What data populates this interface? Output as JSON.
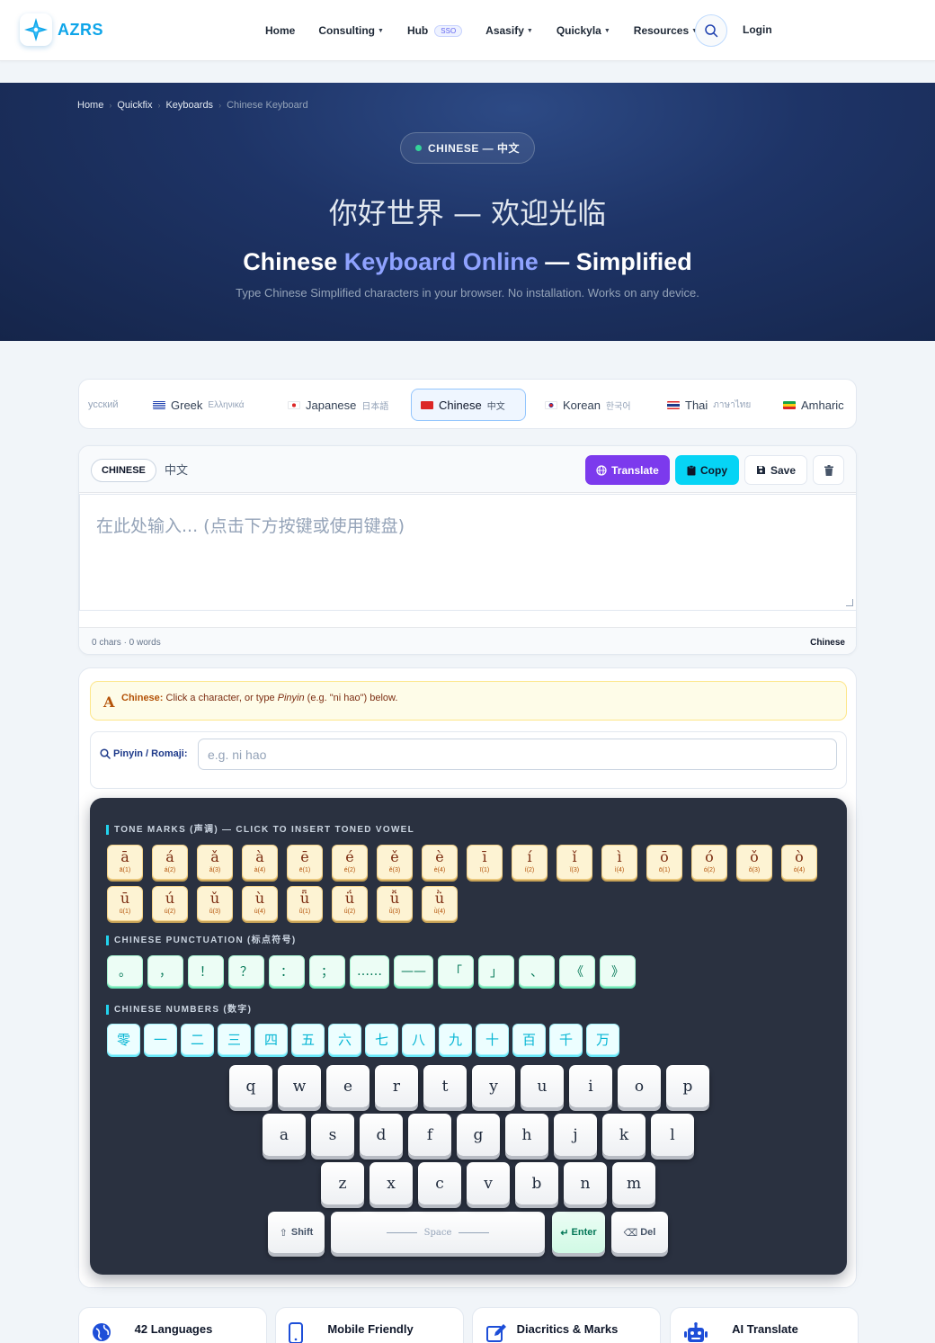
{
  "brand": {
    "name": "AZRS"
  },
  "nav": {
    "items": [
      {
        "label": "Home",
        "dropdown": false
      },
      {
        "label": "Consulting",
        "dropdown": true
      },
      {
        "label": "Hub",
        "dropdown": false,
        "badge": "SSO"
      },
      {
        "label": "Asasify",
        "dropdown": true
      },
      {
        "label": "Quickyla",
        "dropdown": true
      },
      {
        "label": "Resources",
        "dropdown": true
      }
    ],
    "login": "Login"
  },
  "breadcrumb": [
    "Home",
    "Quickfix",
    "Keyboards",
    "Chinese Keyboard"
  ],
  "hero": {
    "pill": "CHINESE — 中文",
    "greeting": "你好世界 — 欢迎光临",
    "title_part1": "Chinese ",
    "title_accent": "Keyboard Online",
    "title_part2": " — Simplified",
    "subtitle": "Type Chinese Simplified characters in your browser. No installation. Works on any device."
  },
  "language_tabs": [
    {
      "label": "",
      "native": "усский",
      "flag": ""
    },
    {
      "label": "Greek",
      "native": "Ελληνικά",
      "flag": "gr"
    },
    {
      "label": "Japanese",
      "native": "日本語",
      "flag": "jp"
    },
    {
      "label": "Chinese",
      "native": "中文",
      "flag": "cn",
      "active": true
    },
    {
      "label": "Korean",
      "native": "한국어",
      "flag": "kr"
    },
    {
      "label": "Thai",
      "native": "ภาษาไทย",
      "flag": "th"
    },
    {
      "label": "Amharic",
      "native": "",
      "flag": "et"
    }
  ],
  "editor": {
    "lang_chip": "CHINESE",
    "lang_native": "中文",
    "translate_label": "Translate",
    "copy_label": "Copy",
    "save_label": "Save",
    "placeholder": "在此处输入... (点击下方按键或使用键盘)",
    "counts": "0 chars · 0 words",
    "status_lang": "Chinese"
  },
  "hint": {
    "bold": "Chinese:",
    "pre": " Click a character, or type ",
    "italic": "Pinyin",
    "post": " (e.g. \"ni hao\") below."
  },
  "pinyin": {
    "label": "Pinyin / Romaji:",
    "placeholder": "e.g. ni hao"
  },
  "sections": {
    "tones": "TONE MARKS (声调) — CLICK TO INSERT TONED VOWEL",
    "punctuation": "CHINESE PUNCTUATION (标点符号)",
    "numbers": "CHINESE NUMBERS (数字)"
  },
  "tones": [
    {
      "c": "ā",
      "s": "ā(1)"
    },
    {
      "c": "á",
      "s": "á(2)"
    },
    {
      "c": "ǎ",
      "s": "ǎ(3)"
    },
    {
      "c": "à",
      "s": "à(4)"
    },
    {
      "c": "ē",
      "s": "ē(1)"
    },
    {
      "c": "é",
      "s": "é(2)"
    },
    {
      "c": "ě",
      "s": "ě(3)"
    },
    {
      "c": "è",
      "s": "è(4)"
    },
    {
      "c": "ī",
      "s": "ī(1)"
    },
    {
      "c": "í",
      "s": "í(2)"
    },
    {
      "c": "ǐ",
      "s": "ǐ(3)"
    },
    {
      "c": "ì",
      "s": "ì(4)"
    },
    {
      "c": "ō",
      "s": "ō(1)"
    },
    {
      "c": "ó",
      "s": "ó(2)"
    },
    {
      "c": "ǒ",
      "s": "ǒ(3)"
    },
    {
      "c": "ò",
      "s": "ò(4)"
    },
    {
      "c": "ū",
      "s": "ū(1)"
    },
    {
      "c": "ú",
      "s": "ú(2)"
    },
    {
      "c": "ǔ",
      "s": "ǔ(3)"
    },
    {
      "c": "ù",
      "s": "ù(4)"
    },
    {
      "c": "ǖ",
      "s": "ǖ(1)"
    },
    {
      "c": "ǘ",
      "s": "ǘ(2)"
    },
    {
      "c": "ǚ",
      "s": "ǚ(3)"
    },
    {
      "c": "ǜ",
      "s": "ǜ(4)"
    }
  ],
  "punctuation": [
    "。",
    "，",
    "！",
    "？",
    "：",
    "；",
    "……",
    "——",
    "「",
    "」",
    "、",
    "《",
    "》"
  ],
  "numbers": [
    "零",
    "一",
    "二",
    "三",
    "四",
    "五",
    "六",
    "七",
    "八",
    "九",
    "十",
    "百",
    "千",
    "万"
  ],
  "keyboard": {
    "row1": [
      "q",
      "w",
      "e",
      "r",
      "t",
      "y",
      "u",
      "i",
      "o",
      "p"
    ],
    "row2": [
      "a",
      "s",
      "d",
      "f",
      "g",
      "h",
      "j",
      "k",
      "l"
    ],
    "row3": [
      "z",
      "x",
      "c",
      "v",
      "b",
      "n",
      "m"
    ],
    "shift": "Shift",
    "space": "Space",
    "enter": "Enter",
    "del": "Del"
  },
  "features": [
    "42 Languages",
    "Mobile Friendly",
    "Diacritics & Marks",
    "AI Translate"
  ],
  "colors": {
    "accent_purple": "#7c3aed",
    "accent_cyan": "#06d4f5",
    "hero_bg": "#1e3467",
    "panel_bg": "#2a3140",
    "brand": "#0ea5e9"
  }
}
